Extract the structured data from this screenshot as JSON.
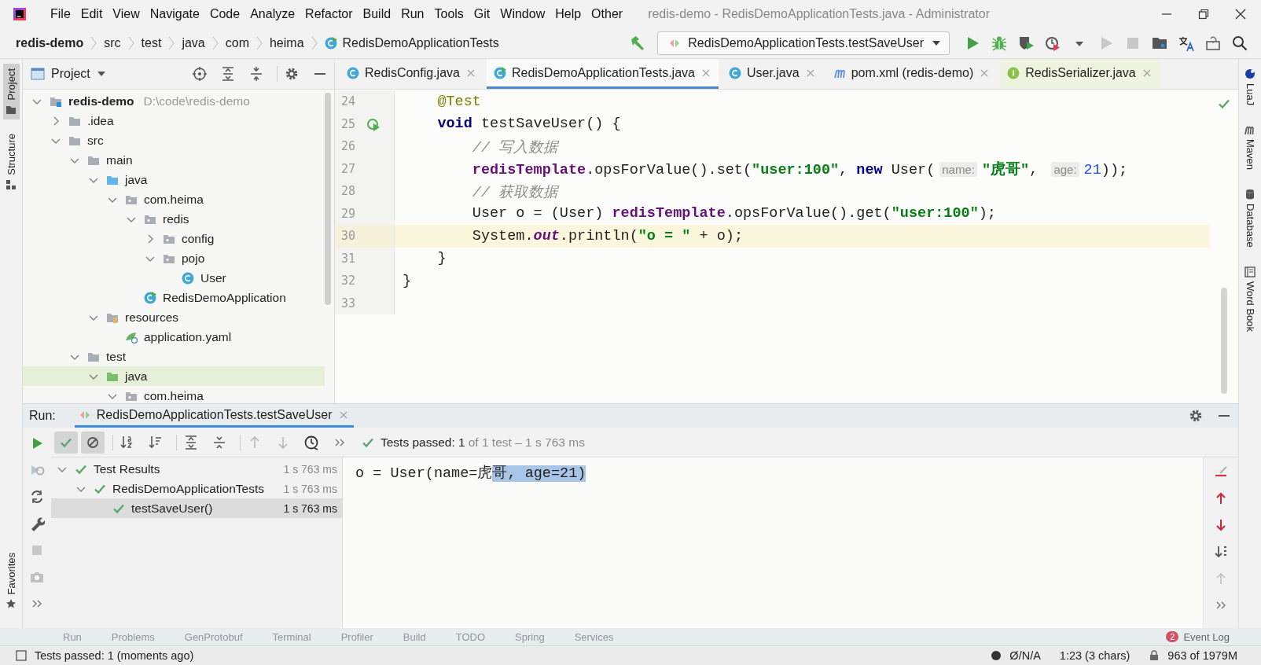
{
  "window": {
    "title": "redis-demo - RedisDemoApplicationTests.java - Administrator"
  },
  "menu": [
    "File",
    "Edit",
    "View",
    "Navigate",
    "Code",
    "Analyze",
    "Refactor",
    "Build",
    "Run",
    "Tools",
    "Git",
    "Window",
    "Help",
    "Other"
  ],
  "breadcrumbs": [
    "redis-demo",
    "src",
    "test",
    "java",
    "com",
    "heima",
    "RedisDemoApplicationTests"
  ],
  "run_config": {
    "label": "RedisDemoApplicationTests.testSaveUser"
  },
  "left_strip": [
    "Project",
    "Structure",
    "Favorites"
  ],
  "right_strip": [
    "LuaJ",
    "Maven",
    "Database",
    "Word Book"
  ],
  "project_panel": {
    "title": "Project",
    "tree": [
      {
        "label": "redis-demo",
        "hint": "D:\\code\\redis-demo",
        "kind": "module",
        "expanded": true,
        "selected": false,
        "children": [
          {
            "label": ".idea",
            "kind": "folder",
            "expanded": false,
            "selected": false
          },
          {
            "label": "src",
            "kind": "folder",
            "expanded": true,
            "selected": false,
            "children": [
              {
                "label": "main",
                "kind": "folder",
                "expanded": true,
                "selected": false,
                "children": [
                  {
                    "label": "java",
                    "kind": "source",
                    "expanded": true,
                    "selected": false,
                    "children": [
                      {
                        "label": "com.heima",
                        "kind": "package",
                        "expanded": true,
                        "selected": false,
                        "children": [
                          {
                            "label": "redis",
                            "kind": "package",
                            "expanded": true,
                            "selected": false,
                            "children": [
                              {
                                "label": "config",
                                "kind": "package",
                                "expanded": false,
                                "selected": false
                              },
                              {
                                "label": "pojo",
                                "kind": "package",
                                "expanded": true,
                                "selected": false,
                                "children": [
                                  {
                                    "label": "User",
                                    "kind": "class",
                                    "selected": false
                                  }
                                ]
                              }
                            ]
                          },
                          {
                            "label": "RedisDemoApplication",
                            "kind": "app",
                            "selected": false
                          }
                        ]
                      }
                    ]
                  },
                  {
                    "label": "resources",
                    "kind": "resources",
                    "expanded": true,
                    "selected": false,
                    "children": [
                      {
                        "label": "application.yaml",
                        "kind": "yaml",
                        "selected": false
                      }
                    ]
                  }
                ]
              },
              {
                "label": "test",
                "kind": "folder",
                "expanded": true,
                "selected": false,
                "children": [
                  {
                    "label": "java",
                    "kind": "test",
                    "expanded": true,
                    "selected": true,
                    "children": [
                      {
                        "label": "com.heima",
                        "kind": "package",
                        "expanded": true,
                        "selected": false
                      }
                    ]
                  }
                ]
              }
            ]
          }
        ]
      }
    ]
  },
  "editor_tabs": [
    {
      "label": "RedisConfig.java",
      "kind": "class",
      "selected": false
    },
    {
      "label": "RedisDemoApplicationTests.java",
      "kind": "app",
      "selected": true
    },
    {
      "label": "User.java",
      "kind": "class",
      "selected": false
    },
    {
      "label": "pom.xml (redis-demo)",
      "kind": "maven",
      "selected": false
    },
    {
      "label": "RedisSerializer.java",
      "kind": "interface",
      "selected": false
    }
  ],
  "editor": {
    "lines": [
      {
        "number": "24",
        "current": false,
        "run_icon": false,
        "tokens": [
          {
            "text": "    @Test",
            "kind": "ann"
          }
        ]
      },
      {
        "number": "25",
        "current": false,
        "run_icon": true,
        "tokens": [
          {
            "text": "    void",
            "kind": "kw"
          },
          {
            "text": " testSaveUser() {",
            "kind": "plain"
          }
        ]
      },
      {
        "number": "26",
        "current": false,
        "run_icon": false,
        "tokens": [
          {
            "text": "        // 写入数据",
            "kind": "comment"
          }
        ]
      },
      {
        "number": "27",
        "current": false,
        "run_icon": false,
        "tokens": [
          {
            "text": "        redisTemplate",
            "kind": "field"
          },
          {
            "text": ".opsForValue().set(",
            "kind": "plain"
          },
          {
            "text": "\"user:100\"",
            "kind": "str"
          },
          {
            "text": ", ",
            "kind": "plain"
          },
          {
            "text": "new",
            "kind": "kw"
          },
          {
            "text": " User(",
            "kind": "plain"
          },
          {
            "text": "name:",
            "kind": "hint"
          },
          {
            "text": "\"虎哥\"",
            "kind": "str"
          },
          {
            "text": ", ",
            "kind": "plain"
          },
          {
            "text": "age:",
            "kind": "hint"
          },
          {
            "text": "21",
            "kind": "num"
          },
          {
            "text": "));",
            "kind": "plain"
          }
        ]
      },
      {
        "number": "28",
        "current": false,
        "run_icon": false,
        "tokens": [
          {
            "text": "        // 获取数据",
            "kind": "comment"
          }
        ]
      },
      {
        "number": "29",
        "current": false,
        "run_icon": false,
        "tokens": [
          {
            "text": "        User o = (User) ",
            "kind": "plain"
          },
          {
            "text": "redisTemplate",
            "kind": "field"
          },
          {
            "text": ".opsForValue().get(",
            "kind": "plain"
          },
          {
            "text": "\"user:100\"",
            "kind": "str"
          },
          {
            "text": ");",
            "kind": "plain"
          }
        ]
      },
      {
        "number": "30",
        "current": true,
        "run_icon": false,
        "tokens": [
          {
            "text": "        System.",
            "kind": "plain"
          },
          {
            "text": "out",
            "kind": "static"
          },
          {
            "text": ".println(",
            "kind": "plain"
          },
          {
            "text": "\"o = \"",
            "kind": "str"
          },
          {
            "text": " + o);",
            "kind": "plain"
          }
        ]
      },
      {
        "number": "31",
        "current": false,
        "run_icon": false,
        "tokens": [
          {
            "text": "    }",
            "kind": "plain"
          }
        ]
      },
      {
        "number": "32",
        "current": false,
        "run_icon": false,
        "tokens": [
          {
            "text": "}",
            "kind": "plain"
          }
        ]
      },
      {
        "number": "33",
        "current": false,
        "run_icon": false
      }
    ]
  },
  "run_panel": {
    "label": "Run:",
    "tab": "RedisDemoApplicationTests.testSaveUser",
    "filters": [
      {
        "kind": "passed",
        "on": true
      },
      {
        "kind": "ignored",
        "on": true
      }
    ],
    "status": {
      "passed": "Tests passed: 1",
      "detail": "of 1 test – 1 s 763 ms"
    },
    "results": [
      {
        "label": "Test Results",
        "time": "1 s 763 ms",
        "passed": true,
        "expanded": true,
        "selected": false,
        "children": [
          {
            "label": "RedisDemoApplicationTests",
            "time": "1 s 763 ms",
            "passed": true,
            "expanded": true,
            "selected": false,
            "children": [
              {
                "label": "testSaveUser()",
                "time": "1 s 763 ms",
                "passed": true,
                "selected": true
              }
            ]
          }
        ]
      }
    ],
    "console": [
      {
        "text": "o = User(name=虎",
        "selected": false
      },
      {
        "text": "哥, age=21)",
        "selected": true
      }
    ]
  },
  "bottom_tools": [
    "Run",
    "Problems",
    "GenProtobuf",
    "Terminal",
    "Profiler",
    "Build",
    "TODO",
    "Spring",
    "Services"
  ],
  "event_log": {
    "label": "Event Log",
    "count": "2"
  },
  "status_bar": {
    "message": "Tests passed: 1 (moments ago)",
    "items": [
      "Ø/N/A",
      "1:23 (3 chars)",
      "963 of 1979M"
    ]
  }
}
